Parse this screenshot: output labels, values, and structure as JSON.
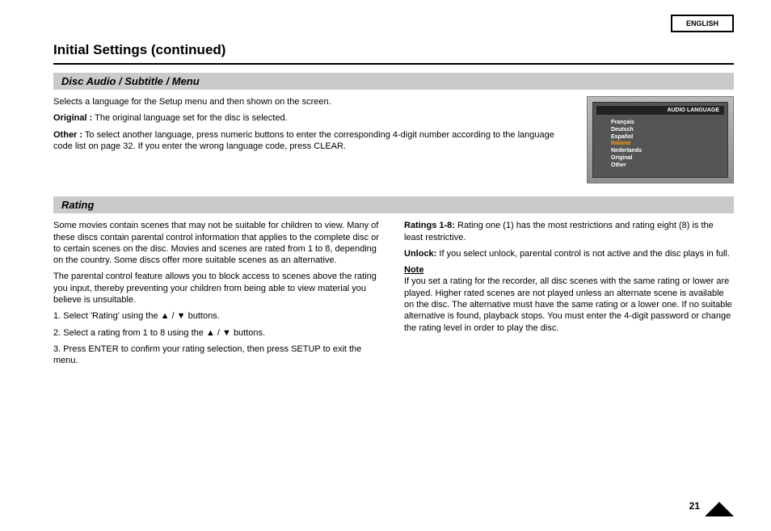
{
  "tab": "ENGLISH",
  "page_number": "21",
  "title": "Initial Settings (continued)",
  "section1": {
    "heading": "Disc Audio / Subtitle / Menu",
    "primary": "Selects a language for the Setup menu and then shown on the screen.",
    "original_label": "Original :",
    "original_text": "The original language set for the disc is selected.",
    "other_label": "Other :",
    "other_text": "To select another language, press numeric buttons to enter the corresponding 4-digit number according to the language code list on page 32. If you enter the wrong language code, press CLEAR."
  },
  "osd": {
    "title": "AUDIO LANGUAGE",
    "items": [
      "Français",
      "Deutsch",
      "Español",
      "Italiano",
      "Nederlands",
      "Original",
      "Other"
    ],
    "selected_index": 3
  },
  "section2": {
    "heading": "Rating",
    "p1": "Some movies contain scenes that may not be suitable for children to view. Many of these discs contain parental control information that applies to the complete disc or to certain scenes on the disc. Movies and scenes are rated from 1 to 8, depending on the country. Some discs offer more suitable scenes as an alternative.",
    "li1_label": "Ratings 1-8:",
    "li1_text": "Rating one (1) has the most restrictions and rating eight (8) is the least restrictive.",
    "li2_label": "Unlock:",
    "li2_text": "If you select unlock, parental control is not active and the disc plays in full.",
    "note_head": "Note",
    "note_text": "If you set a rating for the recorder, all disc scenes with the same rating or lower are played. Higher rated scenes are not played unless an alternate scene is available on the disc. The alternative must have the same rating or a lower one. If no suitable alternative is found, playback stops. You must enter the 4-digit password or change the rating level in order to play the disc.",
    "p2": "The parental control feature allows you to block access to scenes above the rating you input, thereby preventing your children from being able to view material you believe is unsuitable.",
    "steps": [
      "Select a rating from 1 to 8 using the ▲ / ▼ buttons.",
      "Select 'Rating' using the ▲ / ▼ buttons.",
      "Press ENTER to confirm your rating selection, then press SETUP to exit the menu."
    ]
  }
}
